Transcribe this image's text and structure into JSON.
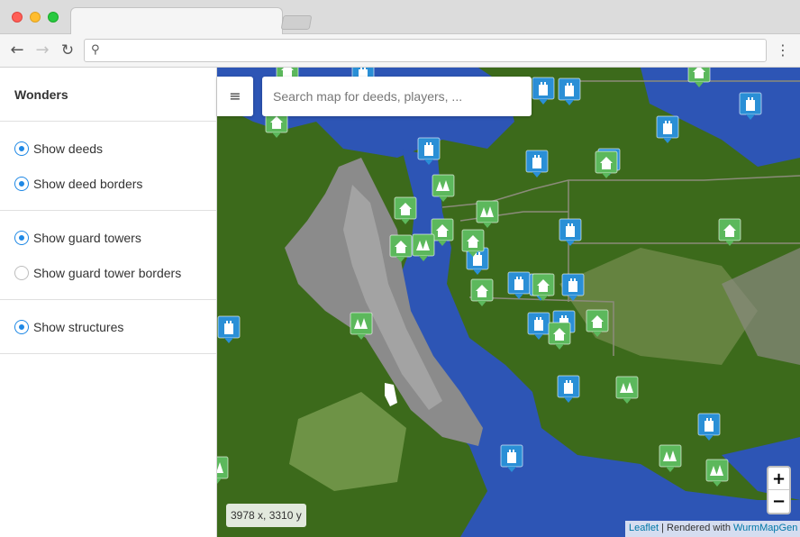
{
  "browser": {
    "controls": [
      "close",
      "minimize",
      "maximize"
    ],
    "active_tab_title": "",
    "url": "",
    "nav_icons": {
      "back": "arrow-left",
      "forward": "arrow-right",
      "reload": "reload",
      "menu": "kebab-menu"
    },
    "nav_glyphs": {
      "back": "←",
      "forward": "→",
      "reload": "↻",
      "menu": "⋮",
      "search": "⚲"
    }
  },
  "sidebar": {
    "title": "Wonders",
    "groups": [
      {
        "items": [
          {
            "label": "Show deeds",
            "checked": true
          },
          {
            "label": "Show deed borders",
            "checked": true
          }
        ]
      },
      {
        "items": [
          {
            "label": "Show guard towers",
            "checked": true
          },
          {
            "label": "Show guard tower borders",
            "checked": false
          }
        ]
      },
      {
        "items": [
          {
            "label": "Show structures",
            "checked": true
          }
        ]
      }
    ]
  },
  "map": {
    "menu_glyph": "≡",
    "search_placeholder": "Search map for deeds, players, ...",
    "zoom_in": "+",
    "zoom_out": "−",
    "coordinates": "3978 x, 3310 y",
    "attribution": {
      "leaflet": "Leaflet",
      "separator": " | Rendered with ",
      "renderer": "WurmMapGen"
    },
    "colors": {
      "water": "#2f55b3",
      "land": "#3d6b1a",
      "mountain": "#8a8a8a",
      "deed_marker": "#5cb85c",
      "tower_marker": "#2a8fd6"
    },
    "marker_counts": {
      "deeds": 22,
      "guard_towers": 19
    }
  }
}
